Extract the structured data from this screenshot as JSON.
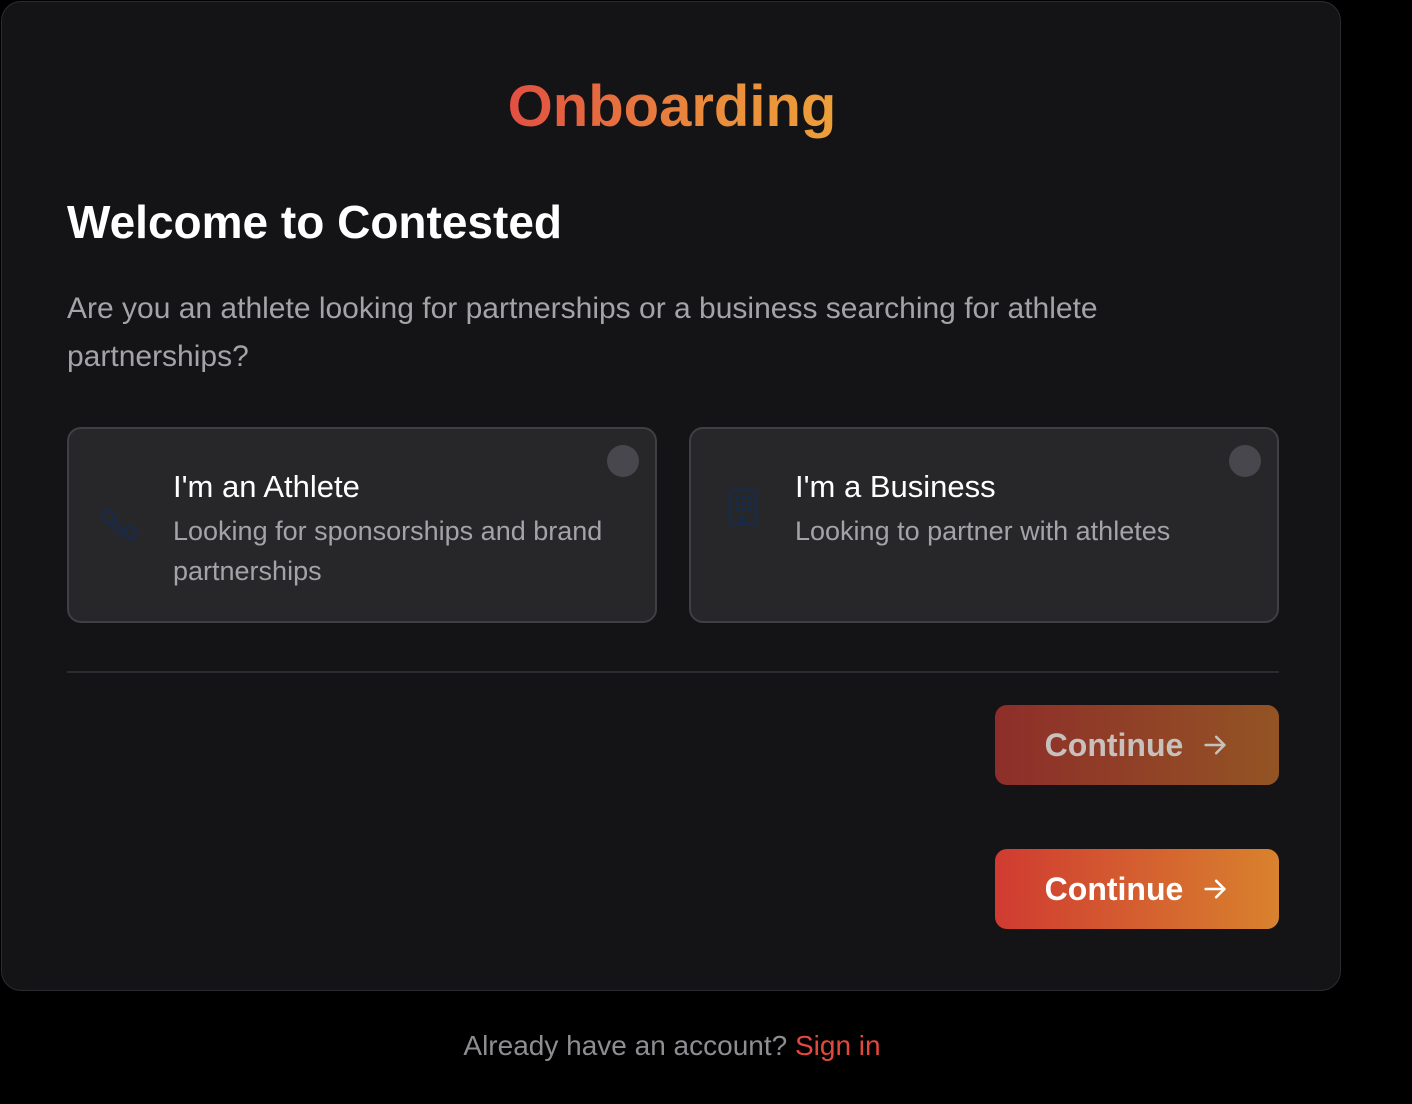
{
  "header": {
    "title": "Onboarding"
  },
  "main": {
    "welcome": "Welcome to Contested",
    "question": "Are you an athlete looking for partnerships or a business searching for athlete partnerships?",
    "options": [
      {
        "title": "I'm an Athlete",
        "description": "Looking for sponsorships and brand partnerships",
        "icon": "dumbbell-icon",
        "selected": false
      },
      {
        "title": "I'm a Business",
        "description": "Looking to partner with athletes",
        "icon": "building-icon",
        "selected": false
      }
    ],
    "continue_disabled_label": "Continue",
    "continue_label": "Continue"
  },
  "footer": {
    "prompt": "Already have an account?",
    "sign_in_label": "Sign in"
  },
  "colors": {
    "background": "#000000",
    "card": "#141416",
    "accent_red": "#e24f42",
    "accent_orange": "#eda03a",
    "icon_navy": "#1b2a44"
  }
}
